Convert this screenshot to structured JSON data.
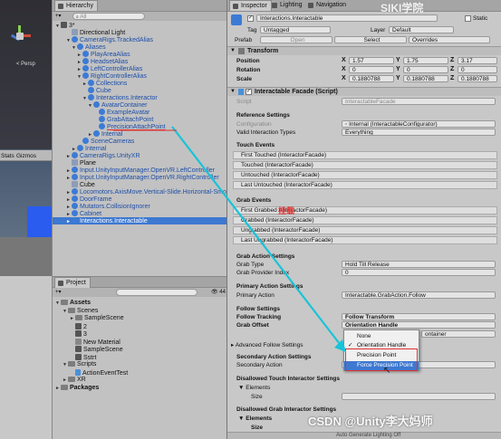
{
  "scene_view": {
    "persp_label": "< Persp",
    "stats_tab": "Stats",
    "gizmos_tab": "Gizmos"
  },
  "hierarchy": {
    "tab": "Hierarchy",
    "search_placeholder": "All",
    "scene": "3*",
    "items": [
      {
        "label": "Directional Light",
        "depth": 2,
        "icon": "gameobject"
      },
      {
        "label": "CameraRigs.TrackedAlias",
        "depth": 2,
        "icon": "prefab",
        "open": true
      },
      {
        "label": "Aliases",
        "depth": 3,
        "icon": "prefab",
        "open": true
      },
      {
        "label": "PlayAreaAlias",
        "depth": 4,
        "icon": "prefab",
        "closed": true
      },
      {
        "label": "HeadsetAlias",
        "depth": 4,
        "icon": "prefab",
        "closed": true
      },
      {
        "label": "LeftControllerAlias",
        "depth": 4,
        "icon": "prefab",
        "closed": true
      },
      {
        "label": "RightControllerAlias",
        "depth": 4,
        "icon": "prefab",
        "open": true
      },
      {
        "label": "Collections",
        "depth": 5,
        "icon": "prefab",
        "closed": true
      },
      {
        "label": "Cube",
        "depth": 5,
        "icon": "prefab",
        "dim": true
      },
      {
        "label": "Interactions.Interactor",
        "depth": 5,
        "icon": "prefab",
        "open": true
      },
      {
        "label": "AvatarContainer",
        "depth": 6,
        "icon": "prefab",
        "open": true
      },
      {
        "label": "ExampleAvatar",
        "depth": 7,
        "icon": "prefab"
      },
      {
        "label": "GrabAttachPoint",
        "depth": 7,
        "icon": "prefab"
      },
      {
        "label": "PrecisionAttachPoint",
        "depth": 7,
        "icon": "prefab",
        "underline": true
      },
      {
        "label": "Internal",
        "depth": 6,
        "icon": "prefab",
        "closed": true
      },
      {
        "label": "SceneCameras",
        "depth": 4,
        "icon": "prefab"
      },
      {
        "label": "Internal",
        "depth": 3,
        "icon": "prefab",
        "closed": true
      },
      {
        "label": "CameraRigs.UnityXR",
        "depth": 2,
        "icon": "prefab",
        "closed": true
      },
      {
        "label": "Plane",
        "depth": 2,
        "icon": "gameobject"
      },
      {
        "label": "Input.UnityInputManager.OpenVR.LeftController",
        "depth": 2,
        "icon": "prefab",
        "closed": true
      },
      {
        "label": "Input.UnityInputManager.OpenVR.RightController",
        "depth": 2,
        "icon": "prefab",
        "closed": true
      },
      {
        "label": "Cube",
        "depth": 2,
        "icon": "gameobject"
      },
      {
        "label": "Locomotors.AxisMove.Vertical-Slide.Horizontal-Smooth",
        "depth": 2,
        "icon": "prefab",
        "closed": true
      },
      {
        "label": "DoorFrame",
        "depth": 2,
        "icon": "prefab",
        "closed": true
      },
      {
        "label": "Mutators.CollisionIgnorer",
        "depth": 2,
        "icon": "prefab",
        "closed": true
      },
      {
        "label": "Cabinet",
        "depth": 2,
        "icon": "prefab",
        "closed": true
      },
      {
        "label": "Interactions.Interactable",
        "depth": 2,
        "icon": "prefab",
        "closed": true,
        "selected": true
      }
    ]
  },
  "project": {
    "tab": "Project",
    "badge": "44",
    "items": [
      {
        "label": "Assets",
        "depth": 0,
        "kind": "folder",
        "open": true
      },
      {
        "label": "Scenes",
        "depth": 1,
        "kind": "folder",
        "open": true
      },
      {
        "label": "SampleScene",
        "depth": 2,
        "kind": "folder",
        "closed": true
      },
      {
        "label": "2",
        "depth": 2,
        "kind": "scene"
      },
      {
        "label": "3",
        "depth": 2,
        "kind": "scene"
      },
      {
        "label": "New Material",
        "depth": 2,
        "kind": "material"
      },
      {
        "label": "SampleScene",
        "depth": 2,
        "kind": "scene"
      },
      {
        "label": "Sstrt",
        "depth": 2,
        "kind": "scene"
      },
      {
        "label": "Scripts",
        "depth": 1,
        "kind": "folder",
        "open": true
      },
      {
        "label": "ActionEventTest",
        "depth": 2,
        "kind": "script"
      },
      {
        "label": "XR",
        "depth": 1,
        "kind": "folder",
        "closed": true
      },
      {
        "label": "Packages",
        "depth": 0,
        "kind": "folder",
        "closed": true
      }
    ]
  },
  "inspector": {
    "tabs": [
      "Inspector",
      "Lighting",
      "Navigation"
    ],
    "object_name": "Interactions.Interactable",
    "static_label": "Static",
    "tag_label": "Tag",
    "tag_value": "Untagged",
    "layer_label": "Layer",
    "layer_value": "Default",
    "prefab_label": "Prefab",
    "prefab_open": "Open",
    "prefab_select": "Select",
    "prefab_overrides": "Overrides",
    "transform_title": "Transform",
    "position_label": "Position",
    "rotation_label": "Rotation",
    "scale_label": "Scale",
    "position": {
      "x": "1.57",
      "y": "1.75",
      "z": "3.17"
    },
    "rotation": {
      "x": "0",
      "y": "0",
      "z": "0"
    },
    "scale": {
      "x": "0.1880788",
      "y": "0.1880788",
      "z": "0.1880788"
    },
    "facade_title": "Interactable Facade (Script)",
    "script_label": "Script",
    "script_value": "InteractableFacade",
    "reference_settings": "Reference Settings",
    "configuration_label": "Configuration",
    "configuration_value": "Internal (InteractableConfigurator)",
    "valid_interaction_label": "Valid Interaction Types",
    "valid_interaction_value": "Everything",
    "touch_events": "Touch Events",
    "touch_event_list": [
      "First Touched (InteractorFacade)",
      "Touched (InteractorFacade)",
      "Untouched (InteractorFacade)",
      "Last Untouched (InteractorFacade)"
    ],
    "grab_events": "Grab Events",
    "grab_event_list": [
      "First Grabbed (InteractorFacade)",
      "Grabbed (InteractorFacade)",
      "Ungrabbed (InteractorFacade)",
      "Last Ungrabbed (InteractorFacade)"
    ],
    "grab_action_settings": "Grab Action Settings",
    "grab_type_label": "Grab Type",
    "grab_type_value": "Hold Till Release",
    "grab_provider_label": "Grab Provider Index",
    "grab_provider_value": "0",
    "primary_action_settings": "Primary Action Settings",
    "primary_action_label": "Primary Action",
    "primary_action_value": "Interactable.GrabAction.Follow",
    "follow_settings": "Follow Settings",
    "follow_tracking_label": "Follow Tracking",
    "follow_tracking_value": "Follow Transform",
    "grab_offset_label": "Grab Offset",
    "grab_offset_value": "Orientation Handle",
    "container_partial": "ontainer",
    "advanced_follow": "Advanced Follow Settings",
    "secondary_action_settings": "Secondary Action Settings",
    "secondary_action_label": "Secondary Action",
    "disallowed_touch": "Disallowed Touch Interactor Settings",
    "elements_label": "Elements",
    "size_label": "Size",
    "disallowed_grab": "Disallowed Grab Interactor Settings",
    "footer_partial": "Auto Generate Lighting Off"
  },
  "grab_offset_dropdown": {
    "options": [
      "None",
      "Orientation Handle",
      "Precision Point",
      "Force Precision Point"
    ],
    "checked": "Orientation Handle",
    "highlighted": "Force Precision Point"
  },
  "annotations": {
    "red_mark": "挂载",
    "watermark_top": "SIKI学院",
    "watermark_bottom": "CSDN @Unity李大妈师"
  },
  "colors": {
    "selection": "#3d78d1",
    "arrow": "#18c3d8",
    "highlight_box": "#e03030"
  }
}
